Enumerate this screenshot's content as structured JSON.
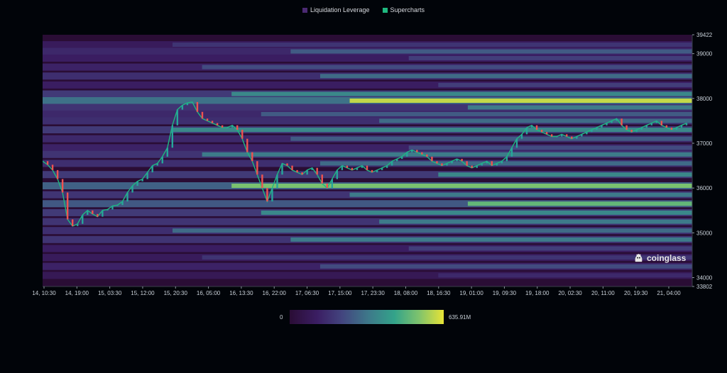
{
  "legend": [
    {
      "label": "Liquidation Leverage",
      "color": "#4b2a73"
    },
    {
      "label": "Supercharts",
      "color": "#1fb87f"
    }
  ],
  "logo_text": "coinglass",
  "colorbar": {
    "min_label": "0",
    "max_label": "635.91M"
  },
  "chart_data": {
    "type": "heatmap",
    "title": "",
    "xlabel": "",
    "ylabel": "",
    "x_ticks": [
      "14, 10:30",
      "14, 19:00",
      "15, 03:30",
      "15, 12:00",
      "15, 20:30",
      "16, 05:00",
      "16, 13:30",
      "16, 22:00",
      "17, 06:30",
      "17, 15:00",
      "17, 23:30",
      "18, 08:00",
      "18, 16:30",
      "19, 01:00",
      "19, 09:30",
      "19, 18:00",
      "20, 02:30",
      "20, 11:00",
      "20, 19:30",
      "21, 04:00"
    ],
    "y_ticks": [
      39422,
      39000,
      38000,
      37000,
      36000,
      35000,
      34000,
      33802
    ],
    "ylim": [
      33802,
      39422
    ],
    "colorbar_range": [
      0,
      635.91
    ],
    "colorbar_unit": "M",
    "legend_position": "top-center",
    "price_line": [
      36600,
      36520,
      36400,
      36200,
      35900,
      35300,
      35150,
      35200,
      35400,
      35500,
      35420,
      35360,
      35500,
      35520,
      35600,
      35620,
      35700,
      35900,
      36050,
      36150,
      36200,
      36350,
      36500,
      36550,
      36700,
      36900,
      37400,
      37750,
      37850,
      37900,
      37920,
      37700,
      37550,
      37500,
      37450,
      37400,
      37350,
      37350,
      37400,
      37300,
      37100,
      36800,
      36600,
      36300,
      36000,
      35700,
      36000,
      36300,
      36550,
      36500,
      36400,
      36350,
      36300,
      36400,
      36450,
      36300,
      36100,
      36000,
      36200,
      36400,
      36500,
      36450,
      36400,
      36450,
      36500,
      36400,
      36350,
      36400,
      36450,
      36500,
      36600,
      36650,
      36700,
      36800,
      36850,
      36800,
      36750,
      36700,
      36600,
      36550,
      36500,
      36550,
      36600,
      36650,
      36600,
      36500,
      36450,
      36500,
      36550,
      36600,
      36500,
      36550,
      36600,
      36700,
      36900,
      37100,
      37200,
      37350,
      37400,
      37300,
      37250,
      37200,
      37150,
      37150,
      37200,
      37150,
      37100,
      37150,
      37200,
      37250,
      37300,
      37350,
      37400,
      37450,
      37500,
      37550,
      37400,
      37300,
      37250,
      37300,
      37350,
      37400,
      37450,
      37500,
      37400,
      37350,
      37300,
      37350,
      37400,
      37450
    ],
    "bands": [
      {
        "price": 39200,
        "intensity": 0.3
      },
      {
        "price": 39050,
        "intensity": 0.45
      },
      {
        "price": 38900,
        "intensity": 0.35
      },
      {
        "price": 38700,
        "intensity": 0.4
      },
      {
        "price": 38500,
        "intensity": 0.5
      },
      {
        "price": 38300,
        "intensity": 0.35
      },
      {
        "price": 38100,
        "intensity": 0.6
      },
      {
        "price": 37950,
        "intensity": 0.95
      },
      {
        "price": 37800,
        "intensity": 0.55
      },
      {
        "price": 37650,
        "intensity": 0.45
      },
      {
        "price": 37500,
        "intensity": 0.5
      },
      {
        "price": 37300,
        "intensity": 0.6
      },
      {
        "price": 37100,
        "intensity": 0.45
      },
      {
        "price": 36900,
        "intensity": 0.4
      },
      {
        "price": 36750,
        "intensity": 0.55
      },
      {
        "price": 36550,
        "intensity": 0.5
      },
      {
        "price": 36300,
        "intensity": 0.6
      },
      {
        "price": 36050,
        "intensity": 0.85
      },
      {
        "price": 35850,
        "intensity": 0.55
      },
      {
        "price": 35650,
        "intensity": 0.8
      },
      {
        "price": 35450,
        "intensity": 0.6
      },
      {
        "price": 35250,
        "intensity": 0.55
      },
      {
        "price": 35050,
        "intensity": 0.5
      },
      {
        "price": 34850,
        "intensity": 0.55
      },
      {
        "price": 34650,
        "intensity": 0.35
      },
      {
        "price": 34450,
        "intensity": 0.3
      },
      {
        "price": 34250,
        "intensity": 0.4
      },
      {
        "price": 34050,
        "intensity": 0.25
      }
    ]
  }
}
